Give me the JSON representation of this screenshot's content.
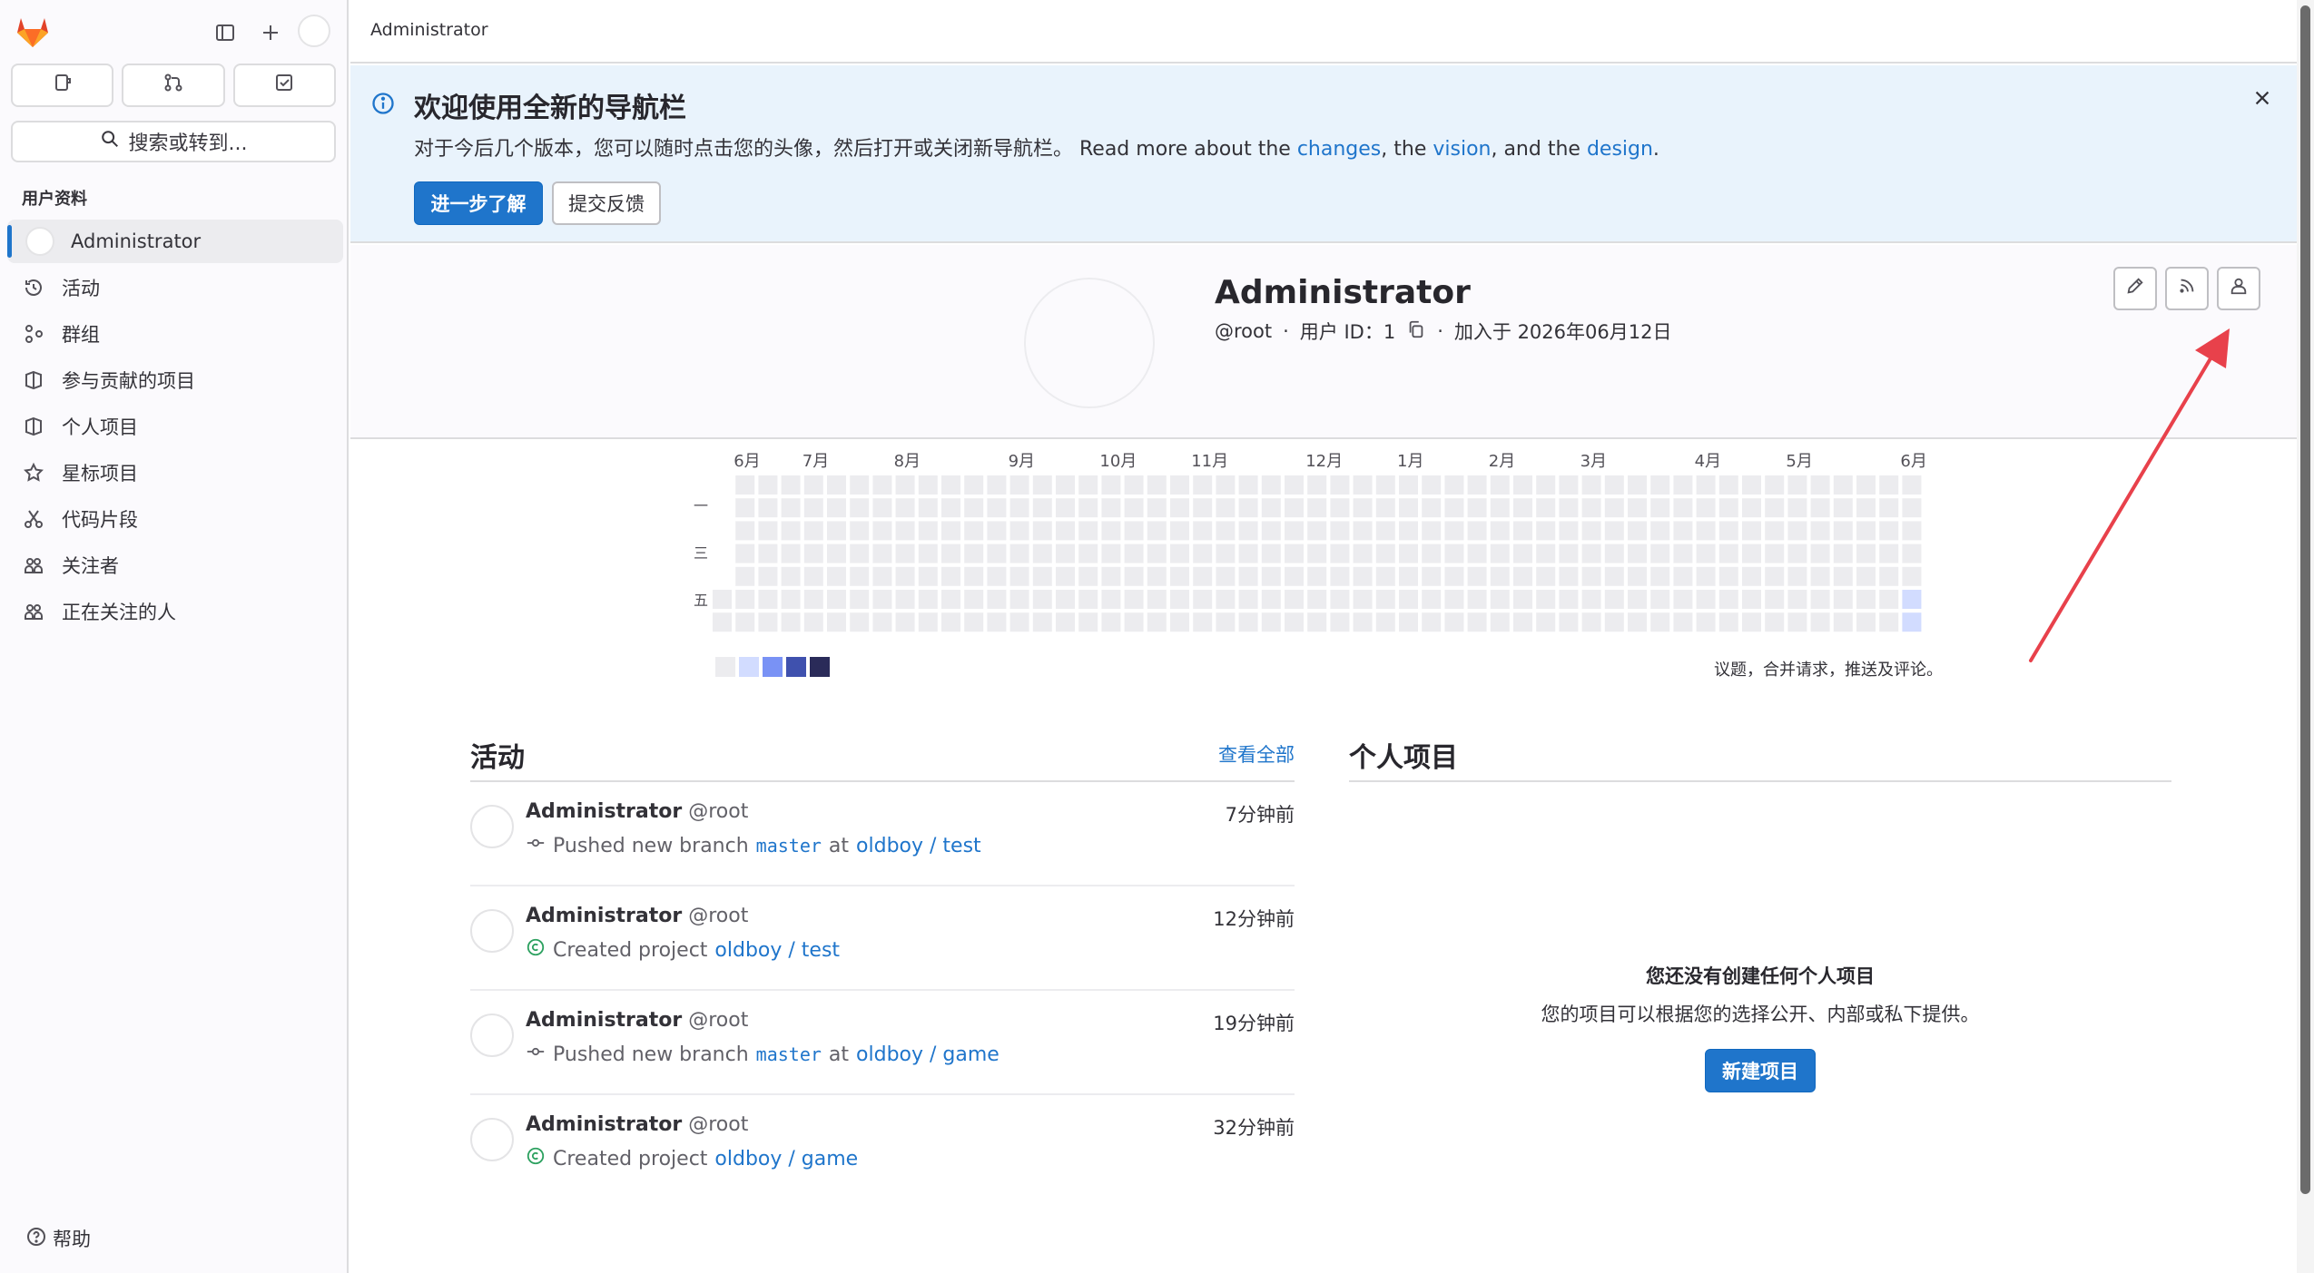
{
  "colors": {
    "accent": "#1f75cb",
    "banner_bg": "#e9f3fc",
    "heat_empty": "#ececef",
    "heat_level1": "#d2dcff",
    "arrow": "#e8414b",
    "created_icon": "#2da160"
  },
  "sidebar": {
    "top_icons": [
      "gitlab-logo",
      "sidebar-toggle-icon",
      "plus-icon",
      "avatar"
    ],
    "tabs": [
      {
        "icon": "issues-icon"
      },
      {
        "icon": "merge-request-icon"
      },
      {
        "icon": "todo-icon"
      }
    ],
    "search_label": "搜索或转到...",
    "section_title": "用户资料",
    "items": [
      {
        "label": "Administrator",
        "icon": "avatar"
      },
      {
        "label": "活动",
        "icon": "history-icon"
      },
      {
        "label": "群组",
        "icon": "group-icon"
      },
      {
        "label": "参与贡献的项目",
        "icon": "project-icon"
      },
      {
        "label": "个人项目",
        "icon": "project-icon"
      },
      {
        "label": "星标项目",
        "icon": "star-icon"
      },
      {
        "label": "代码片段",
        "icon": "snippet-icon"
      },
      {
        "label": "关注者",
        "icon": "users-icon"
      },
      {
        "label": "正在关注的人",
        "icon": "users-icon"
      }
    ],
    "help_label": "帮助"
  },
  "topbar": {
    "breadcrumb": "Administrator"
  },
  "banner": {
    "title": "欢迎使用全新的导航栏",
    "text_prefix": "对于今后几个版本，您可以随时点击您的头像，然后打开或关闭新导航栏。 Read more about the ",
    "link_changes": "changes",
    "text_the": ", the ",
    "link_vision": "vision",
    "text_and": ", and the ",
    "link_design": "design",
    "text_end": ".",
    "learn_more": "进一步了解",
    "feedback": "提交反馈"
  },
  "profile": {
    "name": "Administrator",
    "username": "@root",
    "user_id_label": "用户 ID：1",
    "joined": "加入于 2026年06月12日",
    "action_icons": [
      "pencil-icon",
      "rss-icon",
      "user-icon"
    ]
  },
  "calendar": {
    "months": [
      "6月",
      "7月",
      "8月",
      "9月",
      "10月",
      "11月",
      "12月",
      "1月",
      "2月",
      "3月",
      "4月",
      "5月",
      "6月"
    ],
    "month_week_index": [
      1,
      4,
      8,
      13,
      17,
      21,
      26,
      30,
      34,
      38,
      43,
      47,
      52
    ],
    "day_labels": [
      "一",
      "三",
      "五"
    ],
    "weeks": 53,
    "active_cells": [
      {
        "week": 52,
        "day": 5,
        "level": 1
      },
      {
        "week": 52,
        "day": 6,
        "level": 1
      }
    ],
    "legend_colors": [
      "#ececef",
      "#d2dcff",
      "#7992f5",
      "#3f51ae",
      "#2a2b59"
    ],
    "caption": "议题，合并请求，推送及评论。"
  },
  "activity": {
    "title": "活动",
    "view_all": "查看全部",
    "events": [
      {
        "author": "Administrator",
        "username": "@root",
        "time": "7分钟前",
        "icon": "commit-icon",
        "action": "Pushed new branch",
        "branch": "master",
        "at": "at",
        "project": "oldboy / test"
      },
      {
        "author": "Administrator",
        "username": "@root",
        "time": "12分钟前",
        "icon": "created-icon",
        "action": "Created project",
        "branch": "",
        "at": "",
        "project": "oldboy / test"
      },
      {
        "author": "Administrator",
        "username": "@root",
        "time": "19分钟前",
        "icon": "commit-icon",
        "action": "Pushed new branch",
        "branch": "master",
        "at": "at",
        "project": "oldboy / game"
      },
      {
        "author": "Administrator",
        "username": "@root",
        "time": "32分钟前",
        "icon": "created-icon",
        "action": "Created project",
        "branch": "",
        "at": "",
        "project": "oldboy / game"
      }
    ]
  },
  "projects": {
    "title": "个人项目",
    "empty_title": "您还没有创建任何个人项目",
    "empty_desc": "您的项目可以根据您的选择公开、内部或私下提供。",
    "new_project": "新建项目"
  }
}
